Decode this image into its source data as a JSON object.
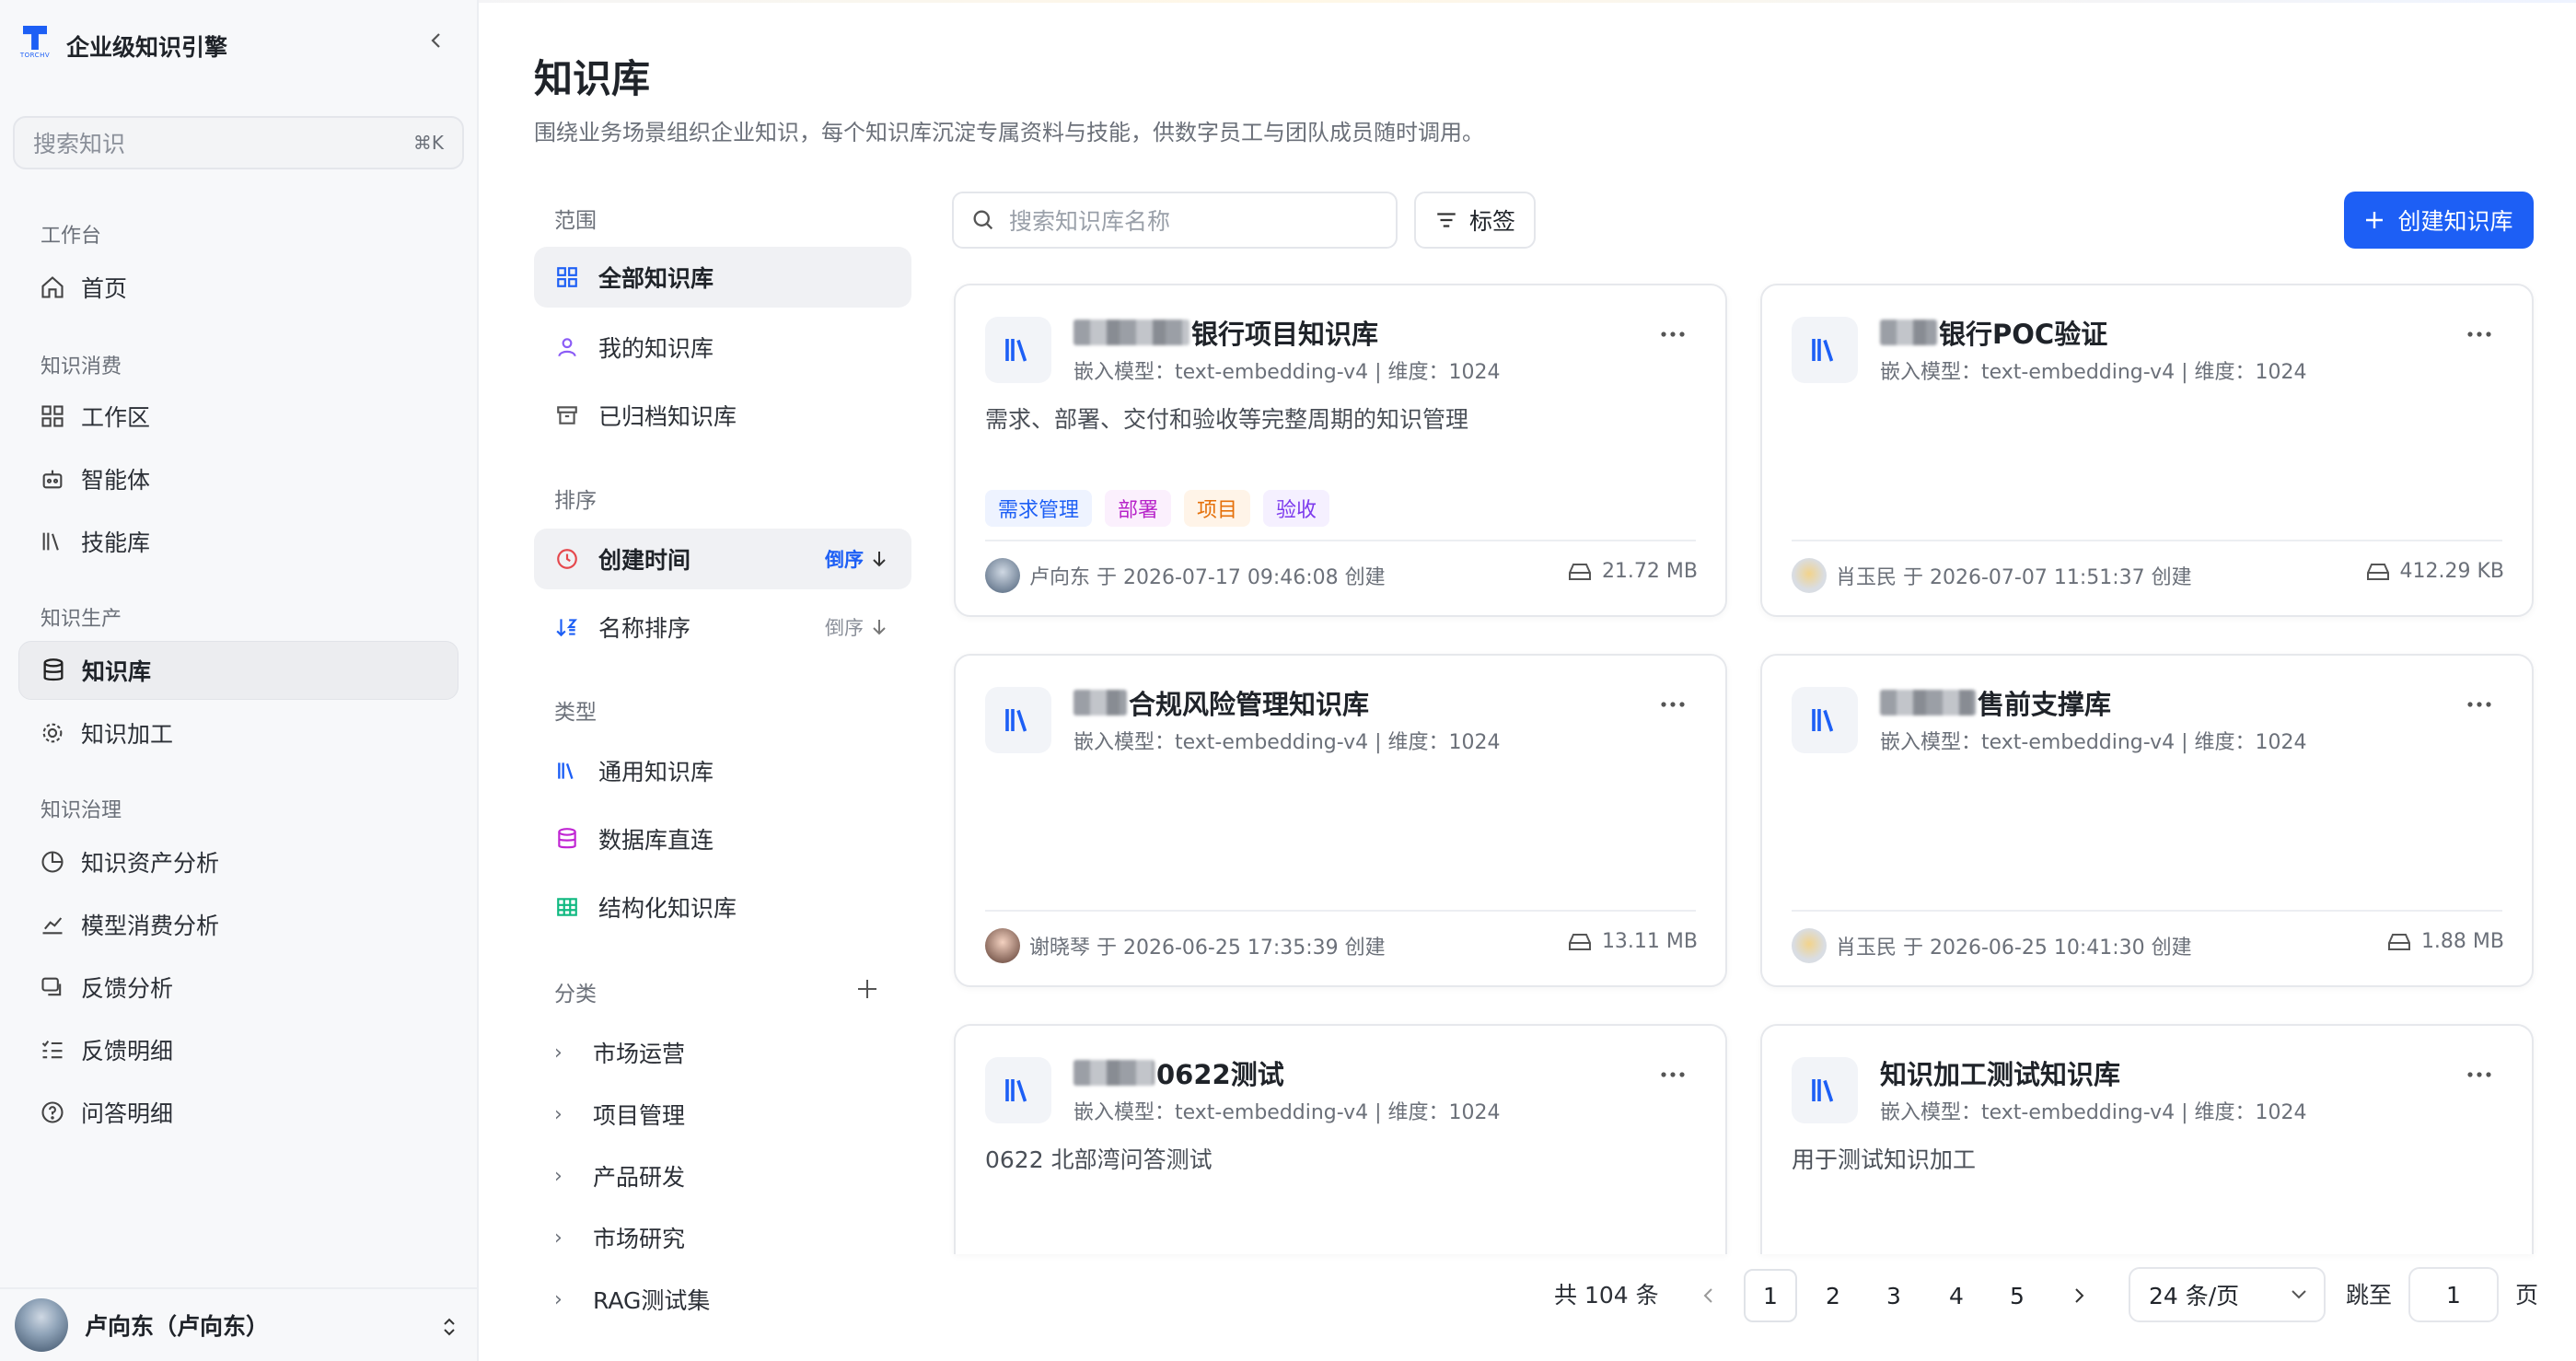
{
  "brand": {
    "name": "企业级知识引擎",
    "logo_text": "TORCHV"
  },
  "search": {
    "placeholder": "搜索知识",
    "shortcut": "⌘K"
  },
  "nav": {
    "sections": [
      "工作台",
      "知识消费",
      "知识生产",
      "知识治理"
    ],
    "items": [
      {
        "label": "首页",
        "icon": "home-icon"
      },
      {
        "label": "工作区",
        "icon": "grid-icon"
      },
      {
        "label": "智能体",
        "icon": "robot-icon"
      },
      {
        "label": "技能库",
        "icon": "library-icon"
      },
      {
        "label": "知识库",
        "icon": "database-icon",
        "active": true
      },
      {
        "label": "知识加工",
        "icon": "gear-icon"
      },
      {
        "label": "知识资产分析",
        "icon": "pie-chart-icon"
      },
      {
        "label": "模型消费分析",
        "icon": "line-chart-icon"
      },
      {
        "label": "反馈分析",
        "icon": "feedback-icon"
      },
      {
        "label": "反馈明细",
        "icon": "checklist-icon"
      },
      {
        "label": "问答明细",
        "icon": "question-icon"
      }
    ]
  },
  "user": {
    "name": "卢向东（卢向东）"
  },
  "page": {
    "title": "知识库",
    "subtitle": "围绕业务场景组织企业知识，每个知识库沉淀专属资料与技能，供数字员工与团队成员随时调用。"
  },
  "filters": {
    "scope_title": "范围",
    "scope": [
      {
        "label": "全部知识库",
        "selected": true
      },
      {
        "label": "我的知识库"
      },
      {
        "label": "已归档知识库"
      }
    ],
    "sort_title": "排序",
    "sort": [
      {
        "label": "创建时间",
        "order": "倒序",
        "selected": true
      },
      {
        "label": "名称排序",
        "order": "倒序"
      }
    ],
    "type_title": "类型",
    "types": [
      {
        "label": "通用知识库"
      },
      {
        "label": "数据库直连"
      },
      {
        "label": "结构化知识库"
      }
    ],
    "category_title": "分类",
    "categories": [
      "市场运营",
      "项目管理",
      "产品研发",
      "市场研究",
      "RAG测试集"
    ]
  },
  "toolbar": {
    "search_placeholder": "搜索知识库名称",
    "tag_label": "标签",
    "create_label": "创建知识库"
  },
  "cards": [
    {
      "name": "银行项目知识库",
      "meta": "嵌入模型：text-embedding-v4 | 维度：1024",
      "desc": "需求、部署、交付和验收等完整周期的知识管理",
      "tags": [
        "需求管理",
        "部署",
        "项目",
        "验收"
      ],
      "creator": "卢向东 于 2026-07-17 09:46:08 创建",
      "size": "21.72 MB"
    },
    {
      "name": "银行POC验证",
      "meta": "嵌入模型：text-embedding-v4 | 维度：1024",
      "desc": "",
      "tags": [],
      "creator": "肖玉民 于 2026-07-07 11:51:37 创建",
      "size": "412.29 KB"
    },
    {
      "name": "合规风险管理知识库",
      "meta": "嵌入模型：text-embedding-v4 | 维度：1024",
      "desc": "",
      "tags": [],
      "creator": "谢晓琴 于 2026-06-25 17:35:39 创建",
      "size": "13.11 MB"
    },
    {
      "name": "售前支撑库",
      "meta": "嵌入模型：text-embedding-v4 | 维度：1024",
      "desc": "",
      "tags": [],
      "creator": "肖玉民 于 2026-06-25 10:41:30 创建",
      "size": "1.88 MB"
    },
    {
      "name": "0622测试",
      "meta": "嵌入模型：text-embedding-v4 | 维度：1024",
      "desc": "0622 北部湾问答测试",
      "tags": [],
      "creator": "",
      "size": ""
    },
    {
      "name": "知识加工测试知识库",
      "meta": "嵌入模型：text-embedding-v4 | 维度：1024",
      "desc": "用于测试知识加工",
      "tags": [],
      "creator": "",
      "size": ""
    }
  ],
  "pagination": {
    "total": "共 104 条",
    "pages": [
      "1",
      "2",
      "3",
      "4",
      "5"
    ],
    "current": "1",
    "page_size": "24 条/页",
    "jump_label": "跳至",
    "jump_value": "1",
    "page_suffix": "页"
  },
  "colors": {
    "accent": "#1d5ff5"
  }
}
